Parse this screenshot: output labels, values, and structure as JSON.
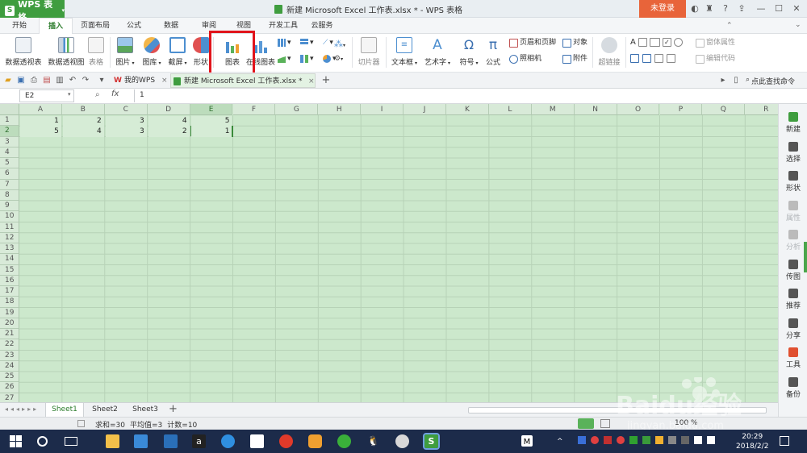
{
  "app": {
    "name": "WPS 表格",
    "login": "未登录"
  },
  "window": {
    "title": "新建 Microsoft Excel 工作表.xlsx * - WPS 表格"
  },
  "menu": {
    "tabs": [
      "开始",
      "插入",
      "页面布局",
      "公式",
      "数据",
      "审阅",
      "视图",
      "开发工具",
      "云服务"
    ],
    "active": "插入"
  },
  "ribbon": {
    "pivot_table": "数据透视表",
    "pivot_chart": "数据透视图",
    "table": "表格",
    "picture": "图片",
    "gallery": "图库",
    "screenshot": "截屏",
    "shape": "形状",
    "chart": "图表",
    "online_chart": "在线图表",
    "slicer": "切片器",
    "textbox": "文本框",
    "wordart": "艺术字",
    "symbol": "符号",
    "formula": "公式",
    "header_footer": "页眉和页脚",
    "object": "对象",
    "camera": "照相机",
    "attachment": "附件",
    "hyperlink": "超链接",
    "form_props": "窗体属性",
    "edit_code": "编辑代码"
  },
  "doc_tabs": [
    {
      "label": "我的WPS"
    },
    {
      "label": "新建 Microsoft Excel 工作表.xlsx *"
    }
  ],
  "search": {
    "label": "点此查找命令"
  },
  "formula_bar": {
    "name_box": "E2",
    "fx": "fx",
    "value": "1"
  },
  "grid": {
    "columns": [
      "A",
      "B",
      "C",
      "D",
      "E",
      "F",
      "G",
      "H",
      "I",
      "J",
      "K",
      "L",
      "M",
      "N",
      "O",
      "P",
      "Q",
      "R"
    ],
    "selected_column": "E",
    "rows": [
      "1",
      "2",
      "3",
      "4",
      "5",
      "6",
      "7",
      "8",
      "9",
      "10",
      "11",
      "12",
      "13",
      "14",
      "15",
      "16",
      "17",
      "18",
      "19",
      "20",
      "21",
      "22",
      "23",
      "24",
      "25",
      "26",
      "27"
    ],
    "selected_row": "2",
    "cells": [
      [
        "1",
        "2",
        "3",
        "4",
        "5"
      ],
      [
        "5",
        "4",
        "3",
        "2",
        "1"
      ]
    ],
    "active_cell": "E2"
  },
  "sheets": {
    "tabs": [
      "Sheet1",
      "Sheet2",
      "Sheet3"
    ],
    "active": "Sheet1"
  },
  "status": {
    "sum": "求和=30",
    "avg": "平均值=3",
    "count": "计数=10",
    "zoom": "100 %"
  },
  "right_panel": {
    "items": [
      {
        "label": "新建",
        "enabled": true
      },
      {
        "label": "选择",
        "enabled": true
      },
      {
        "label": "形状",
        "enabled": true
      },
      {
        "label": "属性",
        "enabled": false
      },
      {
        "label": "分析",
        "enabled": false
      },
      {
        "label": "传图",
        "enabled": true
      },
      {
        "label": "推荐",
        "enabled": true
      },
      {
        "label": "分享",
        "enabled": true
      },
      {
        "label": "工具",
        "enabled": true
      },
      {
        "label": "备份",
        "enabled": true
      }
    ]
  },
  "taskbar": {
    "time": "20:29",
    "date": "2018/2/2"
  },
  "watermark": {
    "text": "Baidu经验",
    "url": "jingyan.baidu.com"
  },
  "colors": {
    "wps_green": "#3f9d3f",
    "login_orange": "#e8643a",
    "sheet_bg": "#cce8cc",
    "highlight_red": "#e1141b",
    "taskbar": "#1c2b4a"
  }
}
